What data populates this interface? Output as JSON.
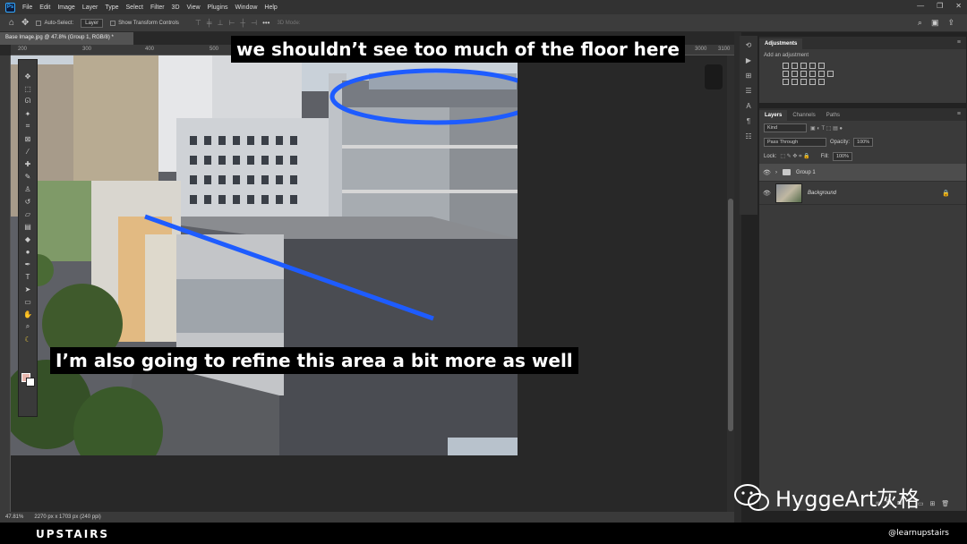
{
  "app": {
    "logo_text": "Ps",
    "menu": [
      "File",
      "Edit",
      "Image",
      "Layer",
      "Type",
      "Select",
      "Filter",
      "3D",
      "View",
      "Plugins",
      "Window",
      "Help"
    ],
    "window_controls": [
      "—",
      "❐",
      "✕"
    ]
  },
  "options_bar": {
    "auto_select_label": "Auto-Select:",
    "auto_select_value": "Layer",
    "show_transform_label": "Show Transform Controls",
    "mode_3d_label": "3D Mode:"
  },
  "document": {
    "tab_title": "Base Image.jpg @ 47.8% (Group 1, RGB/8) *",
    "ruler_ticks": [
      "200",
      "300",
      "400",
      "500",
      "600",
      "700",
      "800",
      "900",
      "3000",
      "3100"
    ]
  },
  "status": {
    "zoom": "47.81%",
    "doc_size": "2270 px x 1703 px (240 ppi)"
  },
  "captions": {
    "top": "we shouldn’t see too much of the floor here",
    "bottom": "I’m also going to refine this area a bit more as well"
  },
  "panels": {
    "adjustments": {
      "tab": "Adjustments",
      "subtitle": "Add an adjustment"
    },
    "layers": {
      "tabs": [
        "Layers",
        "Channels",
        "Paths"
      ],
      "kind_label": "Kind",
      "blend_mode": "Pass Through",
      "opacity_label": "Opacity:",
      "opacity_value": "100%",
      "lock_label": "Lock:",
      "fill_label": "Fill:",
      "fill_value": "100%",
      "items": [
        {
          "name": "Group 1",
          "type": "group"
        },
        {
          "name": "Background",
          "type": "image",
          "locked": true
        }
      ]
    }
  },
  "colors": {
    "foreground": "#e8b7ae",
    "background": "#ffffff",
    "annotation_blue": "#1e5cff"
  },
  "branding": {
    "logo": "UPSTAIRS",
    "handle": "@learnupstairs",
    "watermark": "HyggeArt灰格"
  }
}
